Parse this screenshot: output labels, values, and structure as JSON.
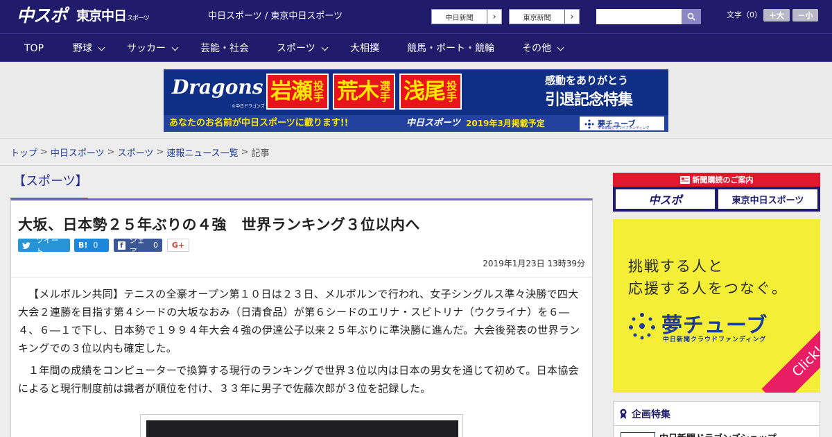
{
  "header": {
    "logo_chuspo": "中スポ",
    "logo_tokyo": "東京中日",
    "logo_tokyo_small": "スポーツ",
    "site_title": "中日スポーツ / 東京中日スポーツ",
    "site_buttons": [
      "中日新聞",
      "東京新聞"
    ],
    "search_placeholder": "",
    "fontsize_label": "文字（0）",
    "fontsize_plus": "＋大",
    "fontsize_minus": "－小"
  },
  "nav": {
    "items": [
      {
        "label": "TOP",
        "dropdown": false
      },
      {
        "label": "野球",
        "dropdown": true
      },
      {
        "label": "サッカー",
        "dropdown": true
      },
      {
        "label": "芸能・社会",
        "dropdown": false
      },
      {
        "label": "スポーツ",
        "dropdown": true
      },
      {
        "label": "大相撲",
        "dropdown": false
      },
      {
        "label": "競馬・ボート・競輪",
        "dropdown": false
      },
      {
        "label": "その他",
        "dropdown": true
      }
    ]
  },
  "banner": {
    "dragons": "Dragons",
    "dragons_sub": "©中日ドラゴンズ",
    "names": [
      {
        "name": "岩瀬",
        "role": "投手"
      },
      {
        "name": "荒木",
        "role": "選手"
      },
      {
        "name": "浅尾",
        "role": "投手"
      }
    ],
    "kando": "感動をありがとう",
    "intai": "引退記念特集",
    "anata": "あなたのお名前が中日スポーツに載ります!!",
    "chu": "中日スポーツ",
    "date": "2019年3月掲載予定",
    "yume": "夢チューブ",
    "yume_sub": "中日新聞クラウドファンディング"
  },
  "breadcrumb": {
    "links": [
      "トップ",
      "中日スポーツ",
      "スポーツ",
      "速報ニュース一覧"
    ],
    "current": "記事"
  },
  "article": {
    "category": "【スポーツ】",
    "headline": "大坂、日本勢２５年ぶりの４強　世界ランキング３位以内へ",
    "share": {
      "tweet": "ツイート",
      "hatena": "B!",
      "hatena_count": "0",
      "facebook": "シェア",
      "facebook_count": "0",
      "gplus": "G+"
    },
    "date": "2019年1月23日 13時39分",
    "paragraphs": [
      "【メルボルン共同】テニスの全豪オープン第１０日は２３日、メルボルンで行われ、女子シングルス準々決勝で四大大会２連勝を目指す第４シードの大坂なおみ（日清食品）が第６シードのエリナ・スビトリナ（ウクライナ）を６―４、６―１で下し、日本勢で１９９４年大会４強の伊達公子以来２５年ぶりに準決勝に進んだ。大会後発表の世界ランキングでの３位以内も確定した。",
      "１年間の成績をコンピューターで換算する現行のランキングで世界３位以内は日本の男女を通じて初めて。日本協会によると現行制度前は識者が順位を付け、３３年に男子で佐藤次郎が３位を記録した。"
    ]
  },
  "sidebar": {
    "subscribe_head": "新聞購読のご案内",
    "subscribe_buttons": [
      "中スポ",
      "東京中日スポーツ"
    ],
    "ad_copy_1": "挑戦する人と",
    "ad_copy_2": "応援する人をつなぐ。",
    "ad_logo": "夢チューブ",
    "ad_sub": "中日新聞クラウドファンディング",
    "ad_click": "Click!",
    "feature_head": "企画特集",
    "feature_item": "中日新聞ドラゴンズショップ"
  },
  "colors": {
    "header_bg": "#201c6b",
    "accent_red": "#e2192e",
    "link": "#1f3c98"
  }
}
